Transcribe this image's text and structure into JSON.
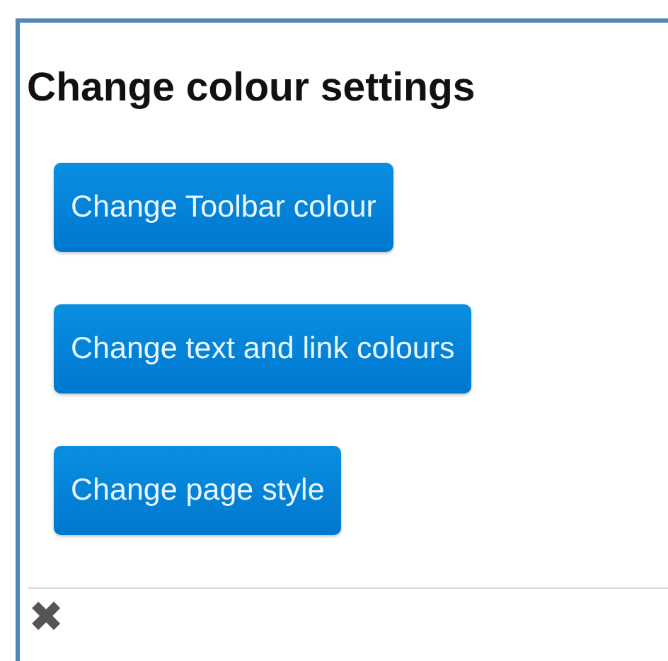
{
  "title": "Change colour settings",
  "buttons": [
    {
      "label": "Change Toolbar colour"
    },
    {
      "label": "Change text and link colours"
    },
    {
      "label": "Change page style"
    }
  ],
  "close": {
    "label": "✖"
  }
}
